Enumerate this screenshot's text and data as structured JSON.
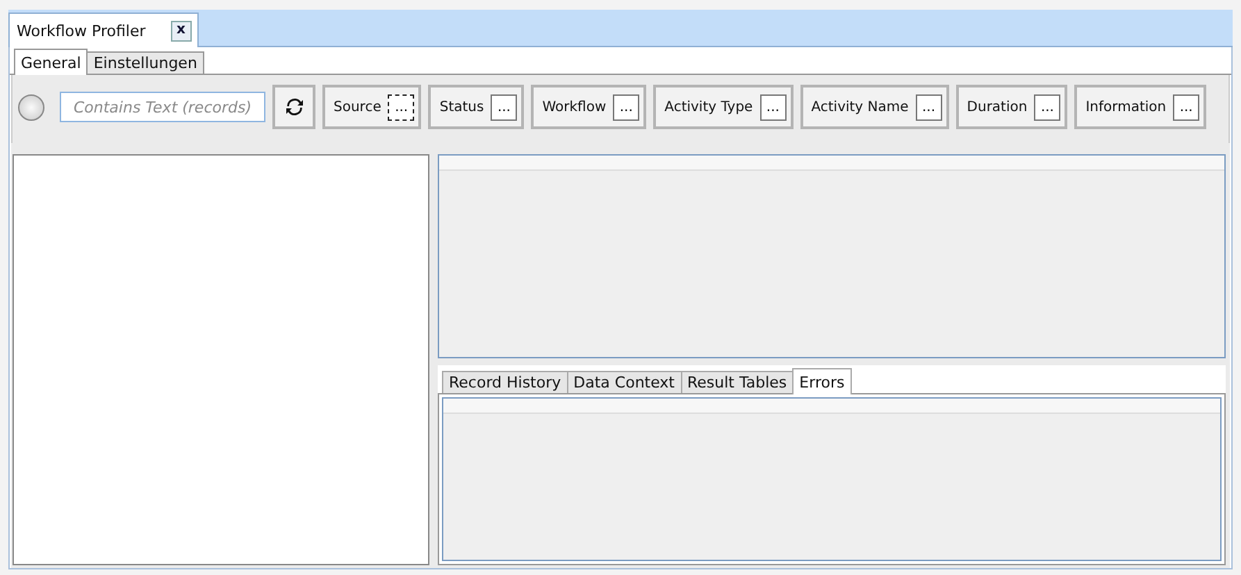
{
  "document_tab": {
    "title": "Workflow Profiler",
    "close": "x"
  },
  "tabs": [
    {
      "label": "General",
      "selected": true
    },
    {
      "label": "Einstellungen",
      "selected": false
    }
  ],
  "toolbar": {
    "search": {
      "placeholder": "Contains Text (records)"
    },
    "filters": [
      {
        "label": "Source",
        "dots": "...",
        "focused": true
      },
      {
        "label": "Status",
        "dots": "...",
        "focused": false
      },
      {
        "label": "Workflow",
        "dots": "...",
        "focused": false
      },
      {
        "label": "Activity Type",
        "dots": "...",
        "focused": false
      },
      {
        "label": "Activity Name",
        "dots": "...",
        "focused": false
      },
      {
        "label": "Duration",
        "dots": "...",
        "focused": false
      },
      {
        "label": "Information",
        "dots": "...",
        "focused": false
      }
    ]
  },
  "detail_tabs": [
    {
      "label": "Record History",
      "selected": false
    },
    {
      "label": "Data Context",
      "selected": false
    },
    {
      "label": "Result Tables",
      "selected": false
    },
    {
      "label": "Errors",
      "selected": true
    }
  ]
}
